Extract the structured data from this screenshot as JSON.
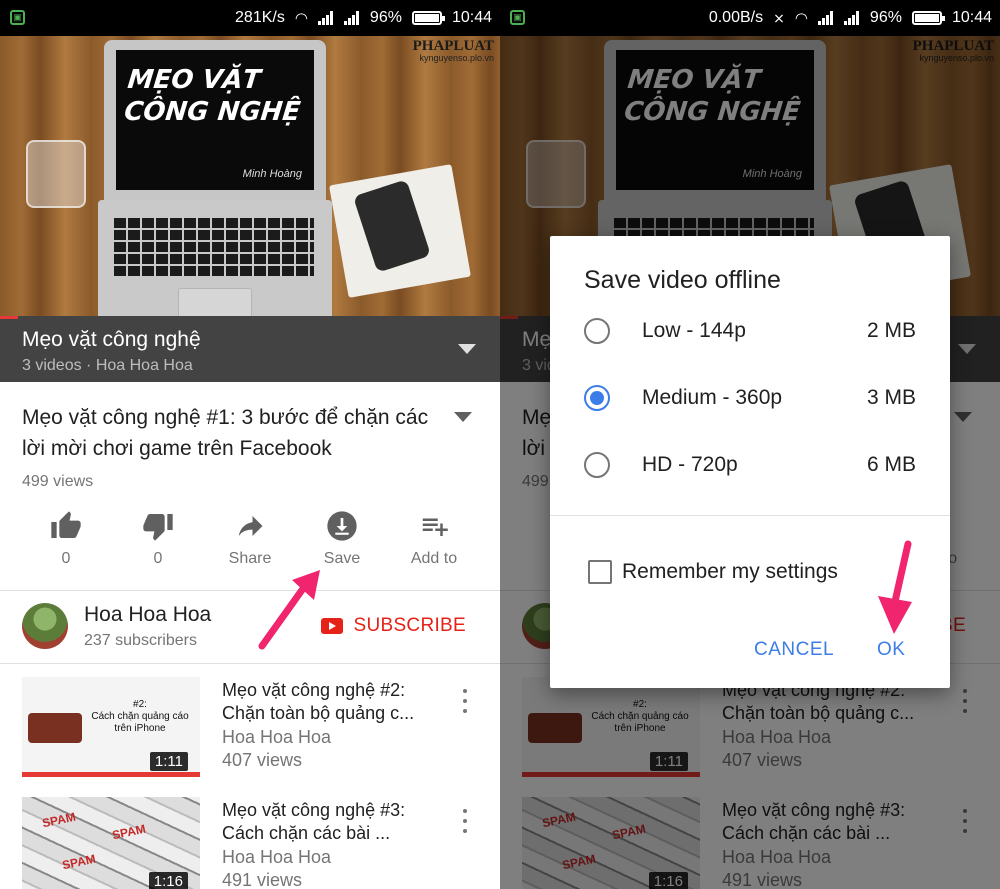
{
  "left": {
    "status": {
      "speed": "281K/s",
      "battery": "96%",
      "time": "10:44"
    },
    "video": {
      "screen_title": "MẸO VẶT\nCÔNG NGHỆ",
      "screen_author": "Minh Hoàng",
      "watermark_brand": "PHAPLUAT",
      "watermark_url": "kynguyenso.plo.vn"
    },
    "playlist": {
      "title": "Mẹo vặt công nghệ",
      "subtitle": "3 videos · Hoa Hoa Hoa"
    },
    "video_info": {
      "title": "Mẹo vặt công nghệ #1: 3 bước để chặn các lời mời chơi game trên Facebook",
      "views": "499 views"
    },
    "actions": [
      {
        "icon": "thumbs-up-icon",
        "label": "0"
      },
      {
        "icon": "thumbs-down-icon",
        "label": "0"
      },
      {
        "icon": "share-icon",
        "label": "Share"
      },
      {
        "icon": "download-icon",
        "label": "Save"
      },
      {
        "icon": "add-to-playlist-icon",
        "label": "Add to"
      }
    ],
    "channel": {
      "name": "Hoa Hoa Hoa",
      "subscribers": "237 subscribers",
      "subscribe": "SUBSCRIBE"
    },
    "list": [
      {
        "title": "Mẹo vặt công nghệ #2: Chặn toàn bộ quảng c...",
        "channel": "Hoa Hoa Hoa",
        "views": "407 views",
        "duration": "1:11",
        "thumb_text": "#2:\nCách chặn quảng cáo\ntrên iPhone"
      },
      {
        "title": "Mẹo vặt công nghệ #3: Cách chặn các bài ...",
        "channel": "Hoa Hoa Hoa",
        "views": "491 views",
        "duration": "1:16",
        "thumb_text": "SPAM"
      }
    ]
  },
  "right": {
    "status": {
      "speed": "0.00B/s",
      "battery": "96%",
      "time": "10:44"
    },
    "dialog": {
      "title": "Save video offline",
      "options": [
        {
          "label": "Low - 144p",
          "size": "2 MB",
          "selected": false
        },
        {
          "label": "Medium - 360p",
          "size": "3 MB",
          "selected": true
        },
        {
          "label": "HD - 720p",
          "size": "6 MB",
          "selected": false
        }
      ],
      "remember": "Remember my settings",
      "cancel": "CANCEL",
      "ok": "OK"
    }
  },
  "colors": {
    "accent_blue": "#3d7de8",
    "youtube_red": "#e62117",
    "annotation_pink": "#f0256d",
    "playlist_bar": "#434343"
  }
}
